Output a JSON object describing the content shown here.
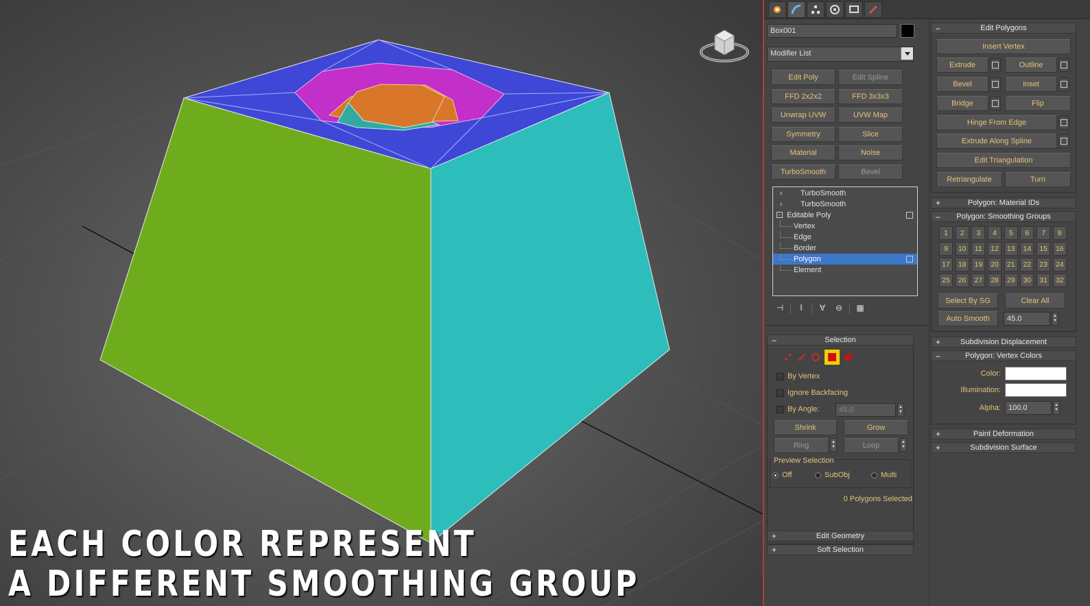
{
  "caption": {
    "line1": "EACH COLOR REPRESENT",
    "line2": "A DIFFERENT SMOOTHING GROUP"
  },
  "colors": {
    "face_left": "#6fac1d",
    "face_right": "#2dbdbb",
    "top": "#3f47d6",
    "inner_ring": "#c22fc9",
    "inner_orange": "#d8772a",
    "inner_teal": "#34a9a1",
    "selection_blue": "#3d77c8",
    "accent_text": "#e6c27a",
    "panel_border": "#b83a3a"
  },
  "tabs": [
    "create-icon",
    "modify-icon",
    "hierarchy-icon",
    "motion-icon",
    "display-icon",
    "utilities-icon"
  ],
  "object": {
    "name": "Box001",
    "modifier_list": "Modifier List"
  },
  "modifier_buttons": [
    {
      "label": "Edit Poly",
      "enabled": true
    },
    {
      "label": "Edit Spline",
      "enabled": false
    },
    {
      "label": "FFD 2x2x2",
      "enabled": true
    },
    {
      "label": "FFD 3x3x3",
      "enabled": true
    },
    {
      "label": "Unwrap UVW",
      "enabled": true
    },
    {
      "label": "UVW Map",
      "enabled": true
    },
    {
      "label": "Symmetry",
      "enabled": true
    },
    {
      "label": "Slice",
      "enabled": true
    },
    {
      "label": "Material",
      "enabled": true
    },
    {
      "label": "Noise",
      "enabled": true
    },
    {
      "label": "TurboSmooth",
      "enabled": true
    },
    {
      "label": "Bevel",
      "enabled": false
    }
  ],
  "stack": [
    {
      "label": "TurboSmooth",
      "level": 0,
      "icon": "bulb-icon"
    },
    {
      "label": "TurboSmooth",
      "level": 0,
      "icon": "bulb-icon"
    },
    {
      "label": "Editable Poly",
      "level": 0,
      "icon": "collapse-icon"
    },
    {
      "label": "Vertex",
      "level": 1
    },
    {
      "label": "Edge",
      "level": 1
    },
    {
      "label": "Border",
      "level": 1
    },
    {
      "label": "Polygon",
      "level": 1,
      "selected": true
    },
    {
      "label": "Element",
      "level": 1
    }
  ],
  "selection": {
    "title": "Selection",
    "by_vertex": "By Vertex",
    "ignore_backfacing": "Ignore Backfacing",
    "by_angle": "By Angle:",
    "angle_value": "45.0",
    "shrink": "Shrink",
    "grow": "Grow",
    "ring": "Ring",
    "loop": "Loop",
    "preview_title": "Preview Selection",
    "preview_off": "Off",
    "preview_subobj": "SubObj",
    "preview_multi": "Multi",
    "status": "0 Polygons Selected"
  },
  "rollouts_left": {
    "edit_geometry": "Edit Geometry",
    "soft_selection": "Soft Selection"
  },
  "edit_polygons": {
    "title": "Edit Polygons",
    "insert_vertex": "Insert Vertex",
    "extrude": "Extrude",
    "outline": "Outline",
    "bevel": "Bevel",
    "inset": "Inset",
    "bridge": "Bridge",
    "flip": "Flip",
    "hinge": "Hinge From Edge",
    "extrude_spline": "Extrude Along Spline",
    "edit_triangulation": "Edit Triangulation",
    "retriangulate": "Retriangulate",
    "turn": "Turn"
  },
  "material_ids": "Polygon: Material IDs",
  "smoothing": {
    "title": "Polygon: Smoothing Groups",
    "groups": [
      "1",
      "2",
      "3",
      "4",
      "5",
      "6",
      "7",
      "8",
      "9",
      "10",
      "11",
      "12",
      "13",
      "14",
      "15",
      "16",
      "17",
      "18",
      "19",
      "20",
      "21",
      "22",
      "23",
      "24",
      "25",
      "26",
      "27",
      "28",
      "29",
      "30",
      "31",
      "32"
    ],
    "select_by_sg": "Select By SG",
    "clear_all": "Clear All",
    "auto_smooth": "Auto Smooth",
    "auto_value": "45.0"
  },
  "subdivision_displacement": "Subdivision Displacement",
  "vertex_colors": {
    "title": "Polygon: Vertex Colors",
    "color": "Color:",
    "illumination": "Illumination:",
    "alpha": "Alpha:",
    "alpha_value": "100.0"
  },
  "paint_deformation": "Paint Deformation",
  "subdivision_surface": "Subdivision Surface"
}
